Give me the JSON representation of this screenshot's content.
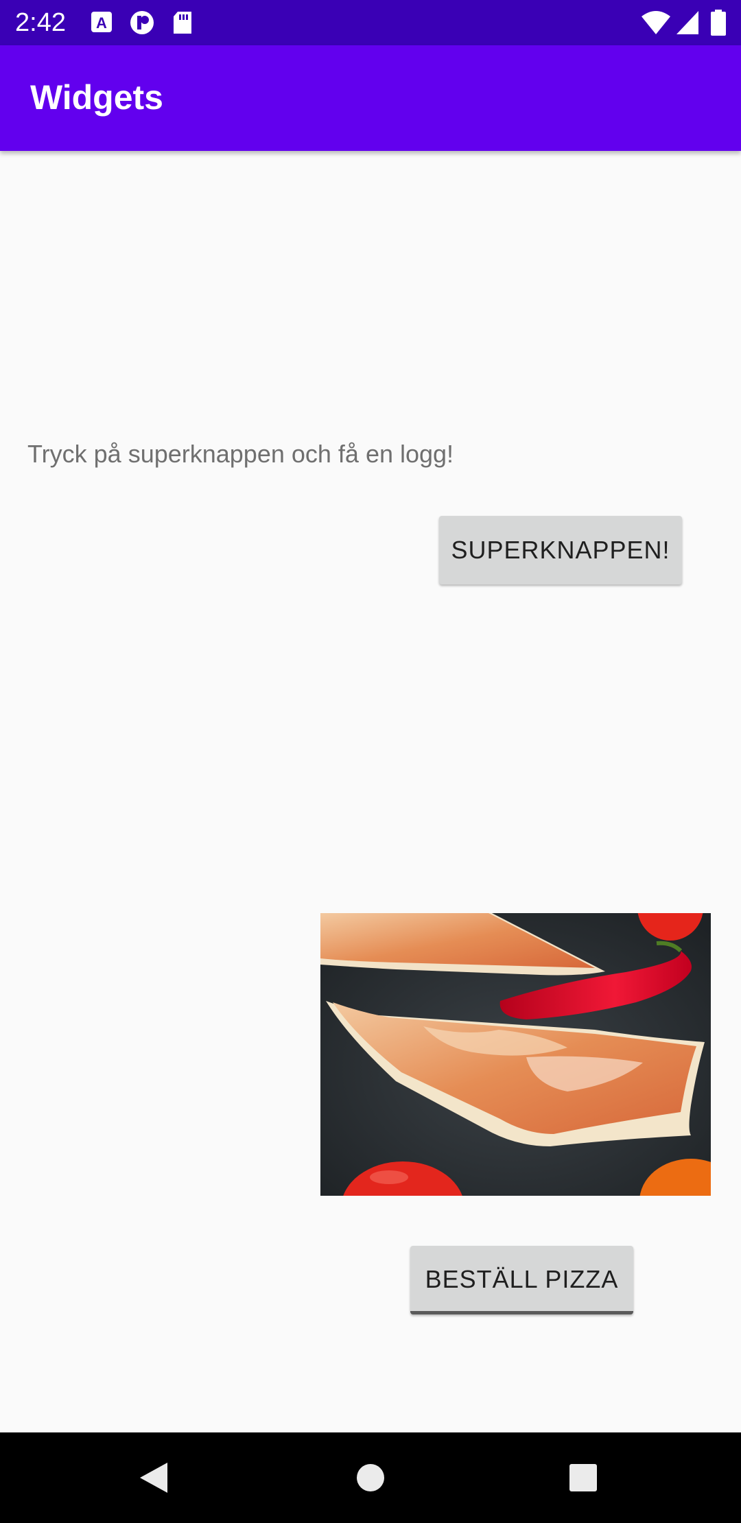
{
  "status_bar": {
    "time": "2:42",
    "background": "#3a00b5",
    "left_icons": [
      "font-a-icon",
      "p-circle-icon",
      "sd-card-icon"
    ],
    "right_icons": [
      "wifi-icon",
      "signal-icon",
      "battery-icon"
    ]
  },
  "app_bar": {
    "title": "Widgets",
    "background": "#6200ee"
  },
  "content": {
    "hint_text": "Tryck på superknappen och få en logg!",
    "super_button_label": "SUPERKNAPPEN!",
    "image_icon": "pizza-photo",
    "order_button_label": "BESTÄLL PIZZA"
  },
  "nav_bar": {
    "buttons": [
      "back-icon",
      "home-icon",
      "recents-icon"
    ]
  }
}
